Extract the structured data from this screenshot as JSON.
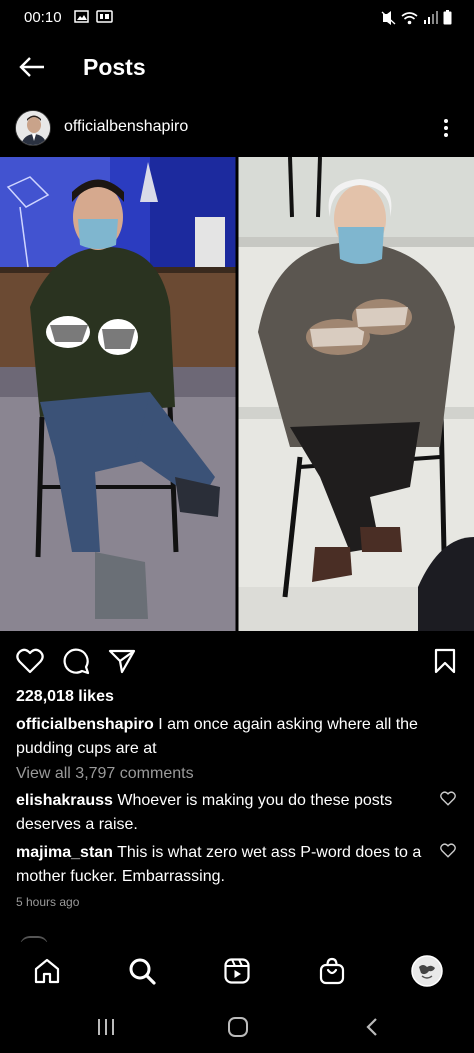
{
  "status_bar": {
    "time": "00:10"
  },
  "header": {
    "title": "Posts"
  },
  "post": {
    "username": "officialbenshapiro",
    "likes": "228,018 likes",
    "caption_user": "officialbenshapiro",
    "caption_text": " I am once again asking where all the pudding cups are at",
    "view_comments": "View all 3,797 comments",
    "comments": [
      {
        "user": "elishakrauss",
        "text": " Whoever is making you do these posts deserves a raise."
      },
      {
        "user": "majima_stan",
        "text": " This is what zero wet ass P-word does to a mother fucker. Embarrassing."
      }
    ],
    "timestamp": "5 hours ago"
  }
}
